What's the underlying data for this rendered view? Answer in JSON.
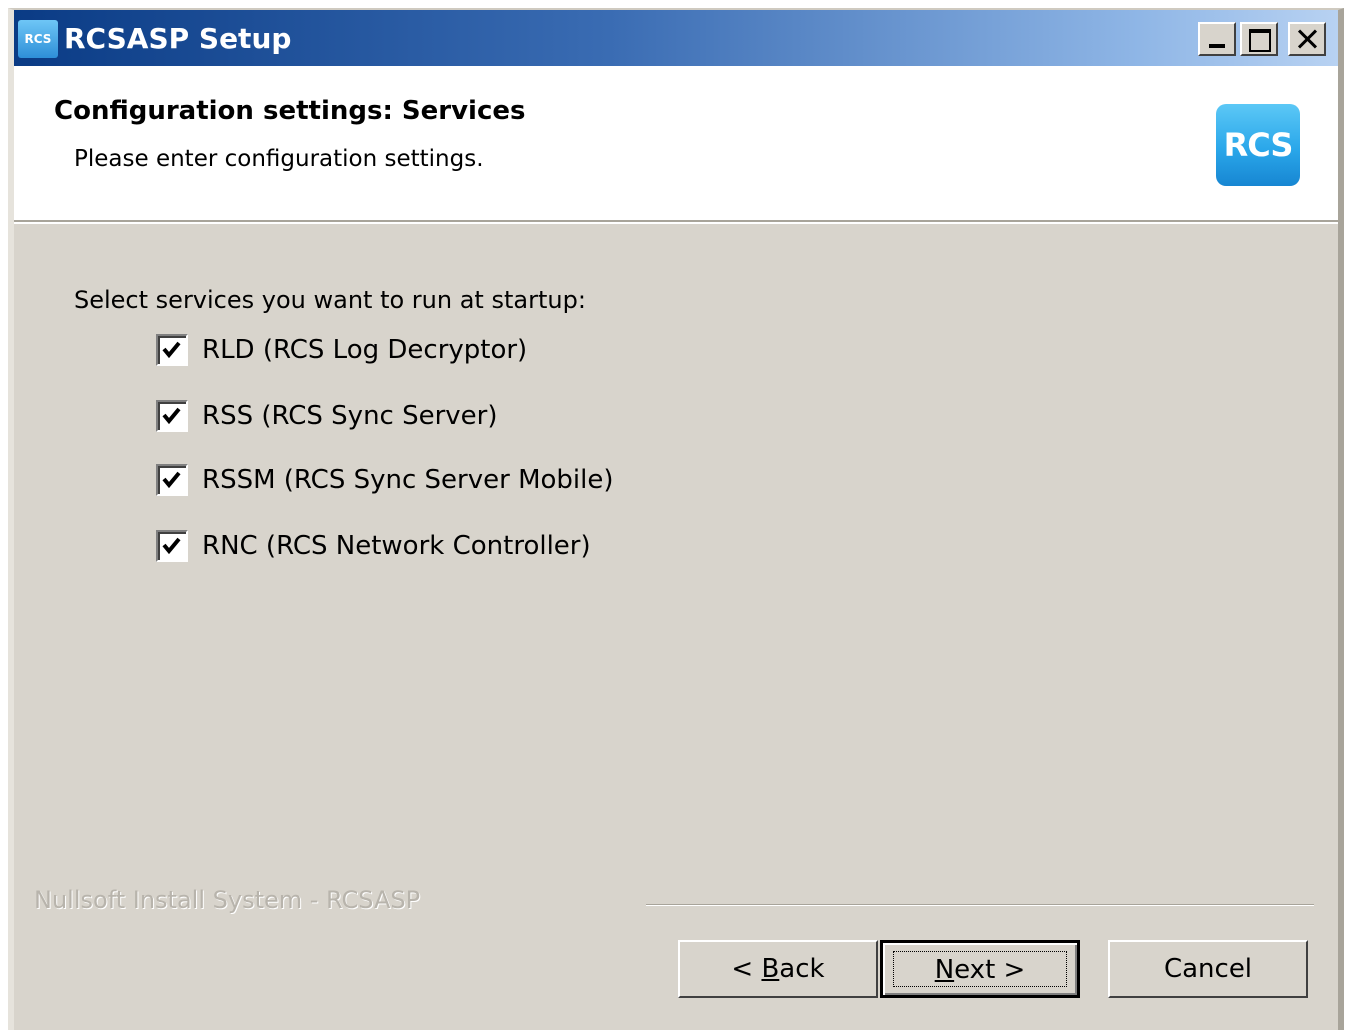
{
  "window": {
    "title": "RCSASP Setup",
    "icon": "rcs-app-icon",
    "icon_label": "RCS",
    "controls": {
      "minimize": "minimize-icon",
      "maximize": "maximize-icon",
      "close": "close-icon"
    }
  },
  "header": {
    "title": "Configuration settings: Services",
    "subtitle": "Please enter configuration settings.",
    "logo_text": "RCS"
  },
  "main": {
    "prompt": "Select services you want to run at startup:",
    "services": [
      {
        "label": "RLD (RCS Log Decryptor)",
        "checked": true
      },
      {
        "label": "RSS (RCS Sync Server)",
        "checked": true
      },
      {
        "label": "RSSM (RCS Sync Server Mobile)",
        "checked": true
      },
      {
        "label": "RNC (RCS Network Controller)",
        "checked": true
      }
    ]
  },
  "footer": {
    "branding": "Nullsoft Install System - RCSASP",
    "buttons": {
      "back": {
        "prefix": "< ",
        "mnemonic": "B",
        "rest": "ack"
      },
      "next": {
        "prefix": "",
        "mnemonic": "N",
        "rest": "ext >"
      },
      "cancel": "Cancel"
    }
  },
  "colors": {
    "title_gradient_start": "#0a3b85",
    "title_gradient_end": "#b8d2f2",
    "dialog_face": "#d8d4cc",
    "logo_blue": "#2aa7ea"
  }
}
